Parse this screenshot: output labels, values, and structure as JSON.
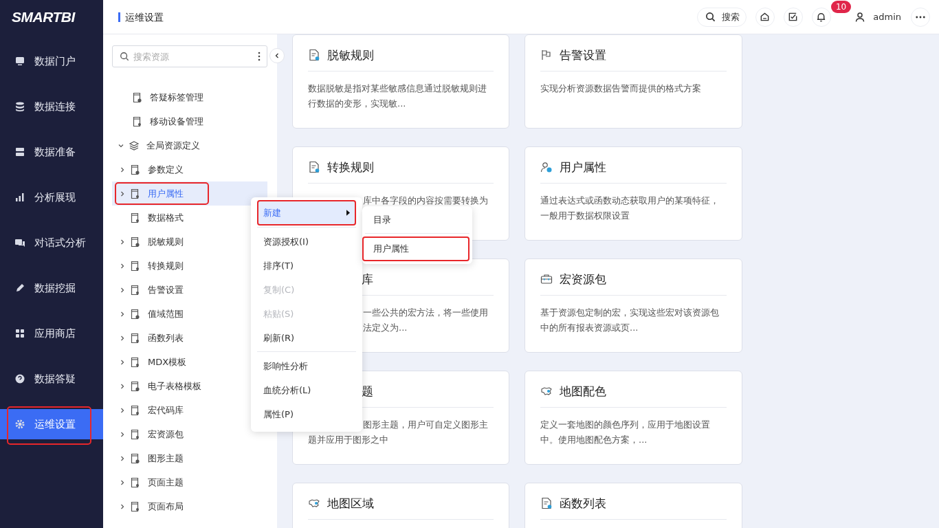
{
  "sidebar": {
    "logo": "SMARTBI",
    "items": [
      {
        "label": "数据门户",
        "selected": false,
        "highlighted": false
      },
      {
        "label": "数据连接",
        "selected": false,
        "highlighted": false
      },
      {
        "label": "数据准备",
        "selected": false,
        "highlighted": false
      },
      {
        "label": "分析展现",
        "selected": false,
        "highlighted": false
      },
      {
        "label": "对话式分析",
        "selected": false,
        "highlighted": false
      },
      {
        "label": "数据挖掘",
        "selected": false,
        "highlighted": false
      },
      {
        "label": "应用商店",
        "selected": false,
        "highlighted": false
      },
      {
        "label": "数据答疑",
        "selected": false,
        "highlighted": false
      },
      {
        "label": "运维设置",
        "selected": true,
        "highlighted": true
      }
    ]
  },
  "topbar": {
    "title": "运维设置",
    "search": "搜索",
    "notification_count": "10",
    "user": "admin"
  },
  "resource_tree": {
    "search": {
      "placeholder": "搜索资源"
    },
    "items": [
      {
        "label": "答疑标签管理",
        "expandable": false,
        "selected": false,
        "highlighted": false
      },
      {
        "label": "移动设备管理",
        "expandable": false,
        "selected": false,
        "highlighted": false
      },
      {
        "label": "全局资源定义",
        "expandable": true,
        "expanded": true,
        "selected": false,
        "highlighted": false,
        "children": [
          {
            "label": "参数定义",
            "expandable": true,
            "expanded": false,
            "selected": false,
            "highlighted": false
          },
          {
            "label": "用户属性",
            "expandable": true,
            "expanded": false,
            "selected": true,
            "highlighted": true
          },
          {
            "label": "数据格式",
            "expandable": false,
            "selected": false,
            "highlighted": false
          },
          {
            "label": "脱敏规则",
            "expandable": true,
            "expanded": false,
            "selected": false,
            "highlighted": false
          },
          {
            "label": "转换规则",
            "expandable": true,
            "expanded": false,
            "selected": false,
            "highlighted": false
          },
          {
            "label": "告警设置",
            "expandable": true,
            "expanded": false,
            "selected": false,
            "highlighted": false
          },
          {
            "label": "值域范围",
            "expandable": true,
            "expanded": false,
            "selected": false,
            "highlighted": false
          },
          {
            "label": "函数列表",
            "expandable": true,
            "expanded": false,
            "selected": false,
            "highlighted": false
          },
          {
            "label": "MDX模板",
            "expandable": true,
            "expanded": false,
            "selected": false,
            "highlighted": false
          },
          {
            "label": "电子表格模板",
            "expandable": true,
            "expanded": false,
            "selected": false,
            "highlighted": false
          },
          {
            "label": "宏代码库",
            "expandable": true,
            "expanded": false,
            "selected": false,
            "highlighted": false
          },
          {
            "label": "宏资源包",
            "expandable": true,
            "expanded": false,
            "selected": false,
            "highlighted": false
          },
          {
            "label": "图形主题",
            "expandable": true,
            "expanded": false,
            "selected": false,
            "highlighted": false
          },
          {
            "label": "页面主题",
            "expandable": true,
            "expanded": false,
            "selected": false,
            "highlighted": false
          },
          {
            "label": "页面布局",
            "expandable": true,
            "expanded": false,
            "selected": false,
            "highlighted": false
          }
        ]
      }
    ]
  },
  "cards": [
    {
      "title": "脱敏规则",
      "title_covered": false,
      "lines": [
        {
          "text": "数据脱敏是指对某些敏感信息通过脱敏规则进",
          "covered": false
        },
        {
          "text": "行数据的变形，实现敏...",
          "covered": false
        }
      ]
    },
    {
      "title": "告警设置",
      "title_covered": false,
      "lines": [
        {
          "text": "实现分析资源数据告警而提供的格式方案",
          "covered": false
        }
      ]
    },
    {
      "title": "转换规则",
      "title_covered": false,
      "lines": [
        {
          "text": "库中各字段的内容按需要转换为",
          "covered": true
        }
      ]
    },
    {
      "title": "用户属性",
      "title_covered": false,
      "lines": [
        {
          "text": "通过表达式或函数动态获取用户的某项特征，",
          "covered": false
        },
        {
          "text": "一般用于数据权限设置",
          "covered": false
        }
      ]
    },
    {
      "title": "库",
      "title_covered": true,
      "lines": [
        {
          "text": "一些公共的宏方法，将一些使用",
          "covered": true
        },
        {
          "text": "法定义为...",
          "covered": true
        }
      ]
    },
    {
      "title": "宏资源包",
      "title_covered": false,
      "lines": [
        {
          "text": "基于资源包定制的宏，实现这些宏对该资源包",
          "covered": false
        },
        {
          "text": "中的所有报表资源或页...",
          "covered": false
        }
      ]
    },
    {
      "title": "题",
      "title_covered": true,
      "lines": [
        {
          "text": "图形主题，用户可自定义图形主",
          "covered": true
        },
        {
          "text": "题并应用于图形之中",
          "covered": false
        }
      ]
    },
    {
      "title": "地图配色",
      "title_covered": false,
      "lines": [
        {
          "text": "定义一套地图的颜色序列，应用于地图设置",
          "covered": false
        },
        {
          "text": "中。使用地图配色方案，...",
          "covered": false
        }
      ]
    },
    {
      "title": "地图区域",
      "title_covered": false
    },
    {
      "title": "函数列表",
      "title_covered": false
    }
  ],
  "context_menu": {
    "groups": [
      [
        {
          "label": "新建",
          "has_submenu": true,
          "selected": true,
          "highlighted": true,
          "disabled": false
        }
      ],
      [
        {
          "label": "资源授权(I)",
          "has_submenu": false,
          "selected": false,
          "highlighted": false,
          "disabled": false
        },
        {
          "label": "排序(T)",
          "has_submenu": false,
          "selected": false,
          "highlighted": false,
          "disabled": false
        },
        {
          "label": "复制(C)",
          "has_submenu": false,
          "selected": false,
          "highlighted": false,
          "disabled": true
        },
        {
          "label": "粘贴(S)",
          "has_submenu": false,
          "selected": false,
          "highlighted": false,
          "disabled": true
        },
        {
          "label": "刷新(R)",
          "has_submenu": false,
          "selected": false,
          "highlighted": false,
          "disabled": false
        }
      ],
      [
        {
          "label": "影响性分析",
          "has_submenu": false,
          "selected": false,
          "highlighted": false,
          "disabled": false
        },
        {
          "label": "血统分析(L)",
          "has_submenu": false,
          "selected": false,
          "highlighted": false,
          "disabled": false
        },
        {
          "label": "属性(P)",
          "has_submenu": false,
          "selected": false,
          "highlighted": false,
          "disabled": false
        }
      ]
    ],
    "submenu": {
      "groups": [
        [
          {
            "label": "目录",
            "highlighted": false
          }
        ],
        [
          {
            "label": "用户属性",
            "highlighted": true
          }
        ]
      ]
    }
  }
}
